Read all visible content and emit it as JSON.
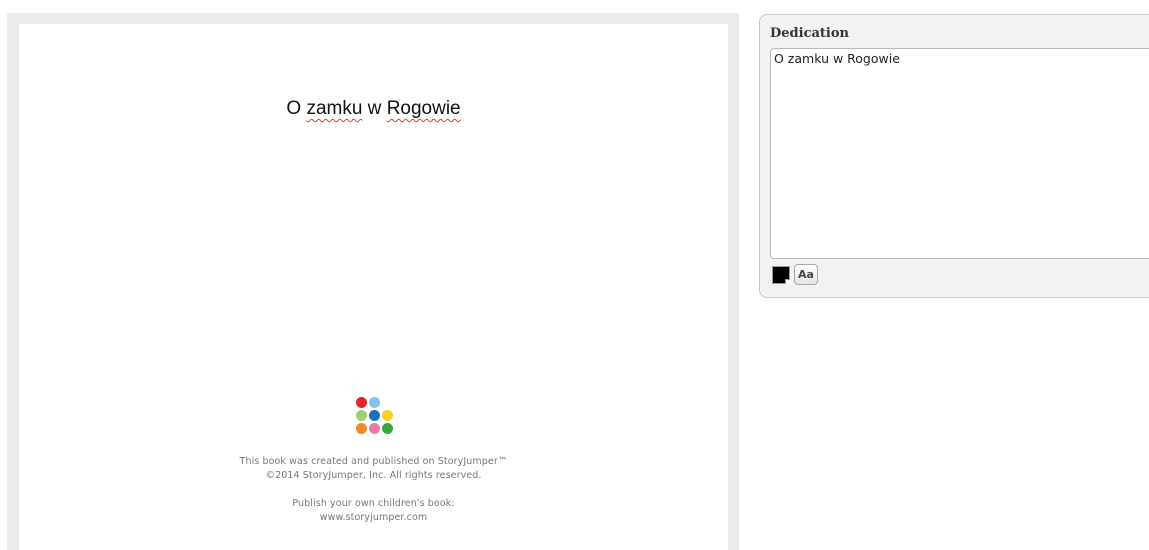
{
  "book_page": {
    "title_words": [
      "O ",
      "zamku",
      " w ",
      "Rogowie"
    ],
    "footer": {
      "line1": "This book was created and published on StoryJumper™",
      "line2": "©2014 StoryJumper, Inc.  All rights reserved.",
      "line3": "Publish your own children's book:",
      "line4": "www.storyjumper.com"
    },
    "logo_dot_colors": [
      "#e3262b",
      "#7fc4ec",
      "#9fcf6b",
      "#1a73b8",
      "#f7d21e",
      "#f08a24",
      "#f07aa6",
      "#3aa63f"
    ]
  },
  "panel": {
    "title": "Dedication",
    "text_value": "O zamku w Rogowie",
    "text_color": "#000000",
    "font_button_label": "Aa"
  }
}
